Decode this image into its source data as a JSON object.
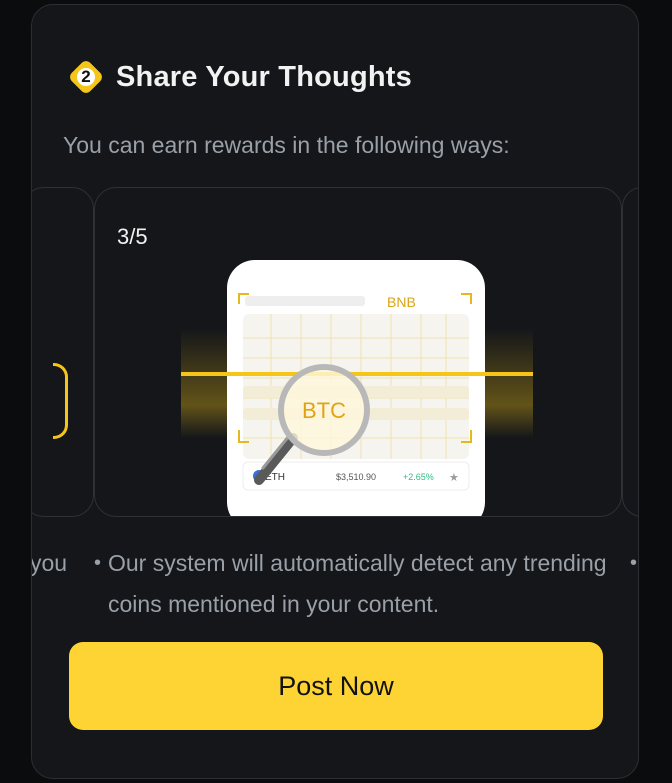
{
  "card": {
    "step_number": "2",
    "title": "Share Your Thoughts",
    "subtitle": "You can earn rewards in the following ways:"
  },
  "carousel": {
    "counter": "3/5",
    "illustration": {
      "top_tag": "BNB",
      "magnified_coin": "BTC",
      "row": {
        "coin": "ETH",
        "price": "$3,510.90",
        "change": "+2.65%"
      }
    },
    "prev_fragment": "you",
    "description": "Our system will automatically detect any trending coins mentioned in your content."
  },
  "cta": {
    "label": "Post Now"
  },
  "colors": {
    "accent": "#fdd433",
    "background": "#0b0c0e",
    "card": "#141619",
    "positive": "#2ebd85"
  }
}
